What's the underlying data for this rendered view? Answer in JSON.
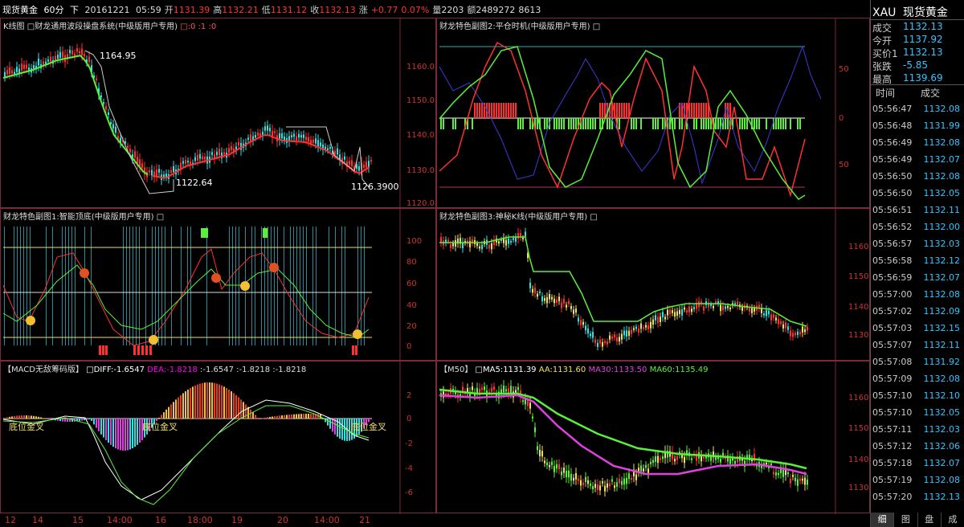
{
  "header": {
    "name": "现货黄金",
    "period": "60分",
    "mode": "下",
    "date": "20161221",
    "time": "05:59",
    "open_label": "开",
    "open": "1131.39",
    "high_label": "高",
    "high": "1132.21",
    "low_label": "低",
    "low": "1131.12",
    "close_label": "收",
    "close": "1132.13",
    "change_label": "涨",
    "change": "+0.77",
    "change_pct": "0.07%",
    "volume_label": "量",
    "volume": "2203",
    "amount_label": "额",
    "amount": "2489272",
    "extra": "8613"
  },
  "panels": {
    "kline": {
      "title": "K线图",
      "subtitle": "□财龙通用波段操盘系统(中级版用户专用)",
      "params": "□:0 :1 :0",
      "high_label": "1164.95",
      "low_label": "1122.64",
      "last_label": "1126.3900",
      "axis": [
        "1160.0",
        "1150.0",
        "1140.0",
        "1130.0",
        "1120.0"
      ]
    },
    "sub2": {
      "title": "财龙特色副图2:平仓时机(中级版用户专用) □",
      "axis": [
        "50",
        "0",
        "50"
      ]
    },
    "sub1": {
      "title": "财龙特色副图1:智能顶底(中级版用户专用) □",
      "axis": [
        "100",
        "80",
        "60",
        "40",
        "20",
        "0"
      ]
    },
    "sub3": {
      "title": "财龙特色副图3:神秘K线(中级版用户专用) □",
      "axis": [
        "1160",
        "1150",
        "1140",
        "1130"
      ]
    },
    "macd": {
      "title": "【MACD无敌筹码版】",
      "diff": "□DIFF:-1.6547",
      "dea": "DEA:-1.8218",
      "v1": ":-1.6547",
      "v2": ":-1.8218",
      "v3": ":-1.8218",
      "labels": [
        "底位金叉",
        "底位金叉",
        "底位金叉"
      ],
      "axis": [
        "2",
        "0",
        "-2",
        "-4",
        "-6"
      ]
    },
    "ma": {
      "title": "【M50】",
      "ma5": "□MA5:1131.39",
      "aa": "AA:1131.60",
      "ma30": "MA30:1133.50",
      "ma60": "MA60:1135.49",
      "axis": [
        "1160",
        "1150",
        "1140",
        "1130"
      ]
    }
  },
  "xaxis": [
    "12",
    "14",
    "15",
    "14:00",
    "16",
    "18:00",
    "19",
    "20",
    "14:00",
    "21"
  ],
  "quote": {
    "symbol": "XAU",
    "name": "现货黄金",
    "rows": [
      {
        "k": "成交",
        "v": "1132.13"
      },
      {
        "k": "今开",
        "v": "1137.92"
      },
      {
        "k": "买价1",
        "v": "1132.13"
      },
      {
        "k": "张跌",
        "v": "-5.85"
      },
      {
        "k": "最高",
        "v": "1139.69"
      }
    ],
    "col_time": "时间",
    "col_price": "成交",
    "ticks": [
      [
        "05:56:47",
        "1132.08"
      ],
      [
        "05:56:48",
        "1131.99"
      ],
      [
        "05:56:49",
        "1132.08"
      ],
      [
        "05:56:49",
        "1132.07"
      ],
      [
        "05:56:50",
        "1132.08"
      ],
      [
        "05:56:50",
        "1132.05"
      ],
      [
        "05:56:51",
        "1132.11"
      ],
      [
        "05:56:52",
        "1132.00"
      ],
      [
        "05:56:57",
        "1132.03"
      ],
      [
        "05:56:58",
        "1132.12"
      ],
      [
        "05:56:59",
        "1132.07"
      ],
      [
        "05:57:00",
        "1132.08"
      ],
      [
        "05:57:02",
        "1132.09"
      ],
      [
        "05:57:03",
        "1132.15"
      ],
      [
        "05:57:07",
        "1132.11"
      ],
      [
        "05:57:08",
        "1131.92"
      ],
      [
        "05:57:09",
        "1132.08"
      ],
      [
        "05:57:10",
        "1132.10"
      ],
      [
        "05:57:10",
        "1132.05"
      ],
      [
        "05:57:11",
        "1132.03"
      ],
      [
        "05:57:12",
        "1132.06"
      ],
      [
        "05:57:18",
        "1132.07"
      ],
      [
        "05:57:19",
        "1132.08"
      ],
      [
        "05:57:20",
        "1132.13"
      ]
    ],
    "tabs": [
      "细",
      "图",
      "盘",
      "成"
    ]
  },
  "colors": {
    "up": "#ff3030",
    "down": "#35e0e0",
    "green": "#5af03a",
    "blue": "#3a3ad8",
    "magenta": "#e040e0",
    "yellow": "#f0e060",
    "axis": "#c33"
  }
}
